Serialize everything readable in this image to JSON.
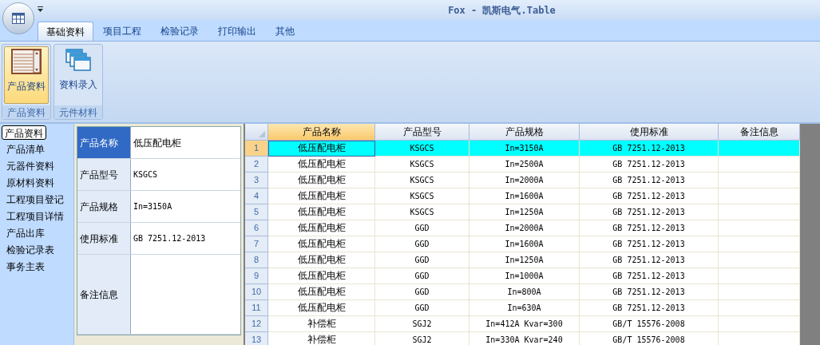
{
  "window": {
    "title": "Fox - 凯斯电气.Table"
  },
  "tabs": [
    {
      "label": "基础资料",
      "selected": true
    },
    {
      "label": "项目工程",
      "selected": false
    },
    {
      "label": "检验记录",
      "selected": false
    },
    {
      "label": "打印输出",
      "selected": false
    },
    {
      "label": "其他",
      "selected": false
    }
  ],
  "ribbon_groups": [
    {
      "label": "产品资料",
      "buttons": [
        {
          "label": "产品资料",
          "kind": "list",
          "selected": true
        }
      ]
    },
    {
      "label": "元件材料",
      "buttons": [
        {
          "label": "资料录入",
          "kind": "windows",
          "selected": false
        }
      ]
    }
  ],
  "sidebar": {
    "items": [
      {
        "label": "产品资料",
        "selected": true
      },
      {
        "label": "产品清单",
        "selected": false
      },
      {
        "label": "元器件资料",
        "selected": false
      },
      {
        "label": "原材料资料",
        "selected": false
      },
      {
        "label": "工程项目登记",
        "selected": false
      },
      {
        "label": "工程项目详情",
        "selected": false
      },
      {
        "label": "产品出库",
        "selected": false
      },
      {
        "label": "检验记录表",
        "selected": false
      },
      {
        "label": "事务主表",
        "selected": false
      }
    ]
  },
  "form": {
    "fields": [
      {
        "label": "产品名称",
        "value": "低压配电柜",
        "selected": true,
        "kind": "single"
      },
      {
        "label": "产品型号",
        "value": "KSGCS",
        "selected": false,
        "kind": "single"
      },
      {
        "label": "产品规格",
        "value": "In=3150A",
        "selected": false,
        "kind": "single"
      },
      {
        "label": "使用标准",
        "value": "GB 7251.12-2013",
        "selected": false,
        "kind": "single"
      },
      {
        "label": "备注信息",
        "selected": false,
        "kind": "multi"
      }
    ]
  },
  "table": {
    "columns": [
      {
        "label": "产品名称",
        "selected": true
      },
      {
        "label": "产品型号",
        "selected": false
      },
      {
        "label": "产品规格",
        "selected": false
      },
      {
        "label": "使用标准",
        "selected": false
      },
      {
        "label": "备注信息",
        "selected": false
      }
    ],
    "rows": [
      {
        "number": "1",
        "cells": [
          "低压配电柜",
          "KSGCS",
          "In=3150A",
          "GB 7251.12-2013"
        ],
        "selected": true
      },
      {
        "number": "2",
        "cells": [
          "低压配电柜",
          "KSGCS",
          "In=2500A",
          "GB 7251.12-2013"
        ],
        "selected": false
      },
      {
        "number": "3",
        "cells": [
          "低压配电柜",
          "KSGCS",
          "In=2000A",
          "GB 7251.12-2013"
        ],
        "selected": false
      },
      {
        "number": "4",
        "cells": [
          "低压配电柜",
          "KSGCS",
          "In=1600A",
          "GB 7251.12-2013"
        ],
        "selected": false
      },
      {
        "number": "5",
        "cells": [
          "低压配电柜",
          "KSGCS",
          "In=1250A",
          "GB 7251.12-2013"
        ],
        "selected": false
      },
      {
        "number": "6",
        "cells": [
          "低压配电柜",
          "GGD",
          "In=2000A",
          "GB 7251.12-2013"
        ],
        "selected": false
      },
      {
        "number": "7",
        "cells": [
          "低压配电柜",
          "GGD",
          "In=1600A",
          "GB 7251.12-2013"
        ],
        "selected": false
      },
      {
        "number": "8",
        "cells": [
          "低压配电柜",
          "GGD",
          "In=1250A",
          "GB 7251.12-2013"
        ],
        "selected": false
      },
      {
        "number": "9",
        "cells": [
          "低压配电柜",
          "GGD",
          "In=1000A",
          "GB 7251.12-2013"
        ],
        "selected": false
      },
      {
        "number": "10",
        "cells": [
          "低压配电柜",
          "GGD",
          "In=800A",
          "GB 7251.12-2013"
        ],
        "selected": false
      },
      {
        "number": "11",
        "cells": [
          "低压配电柜",
          "GGD",
          "In=630A",
          "GB 7251.12-2013"
        ],
        "selected": false
      },
      {
        "number": "12",
        "cells": [
          "补偿柜",
          "SGJ2",
          "In=412A Kvar=300",
          "GB/T 15576-2008"
        ],
        "selected": false
      },
      {
        "number": "13",
        "cells": [
          "补偿柜",
          "SGJ2",
          "In=330A Kvar=240",
          "GB/T 15576-2008"
        ],
        "selected": false
      }
    ]
  }
}
